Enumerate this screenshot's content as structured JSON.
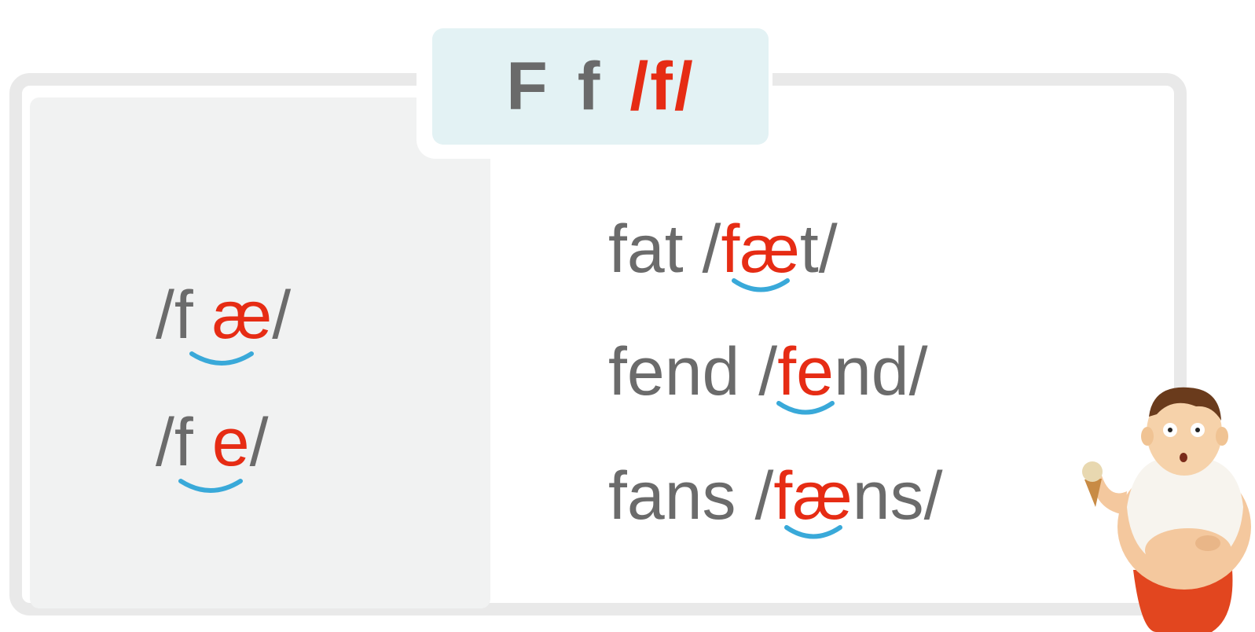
{
  "title": {
    "upper": "F",
    "lower": "f",
    "ipa": "/f/"
  },
  "left_panel": {
    "rows": [
      {
        "open": "/",
        "consonant": "f",
        "gap": " ",
        "vowel": "æ",
        "close": "/"
      },
      {
        "open": "/",
        "consonant": "f",
        "gap": " ",
        "vowel": "e",
        "close": "/"
      }
    ]
  },
  "words": [
    {
      "word": "fat",
      "slash_open": "/",
      "blend": "fæ",
      "rest": "t",
      "slash_close": "/"
    },
    {
      "word": "fend",
      "slash_open": "/",
      "blend": "fe",
      "rest": "nd",
      "slash_close": "/"
    },
    {
      "word": "fans",
      "slash_open": "/",
      "blend": "fæ",
      "rest": "ns",
      "slash_close": "/"
    }
  ],
  "colors": {
    "highlight": "#e62c14",
    "text": "#6b6b6b",
    "link_arc": "#39a9d9",
    "title_bg": "#e3f2f4"
  },
  "icons": [
    "link-arc-icon",
    "boy-with-ice-cream-illustration"
  ]
}
